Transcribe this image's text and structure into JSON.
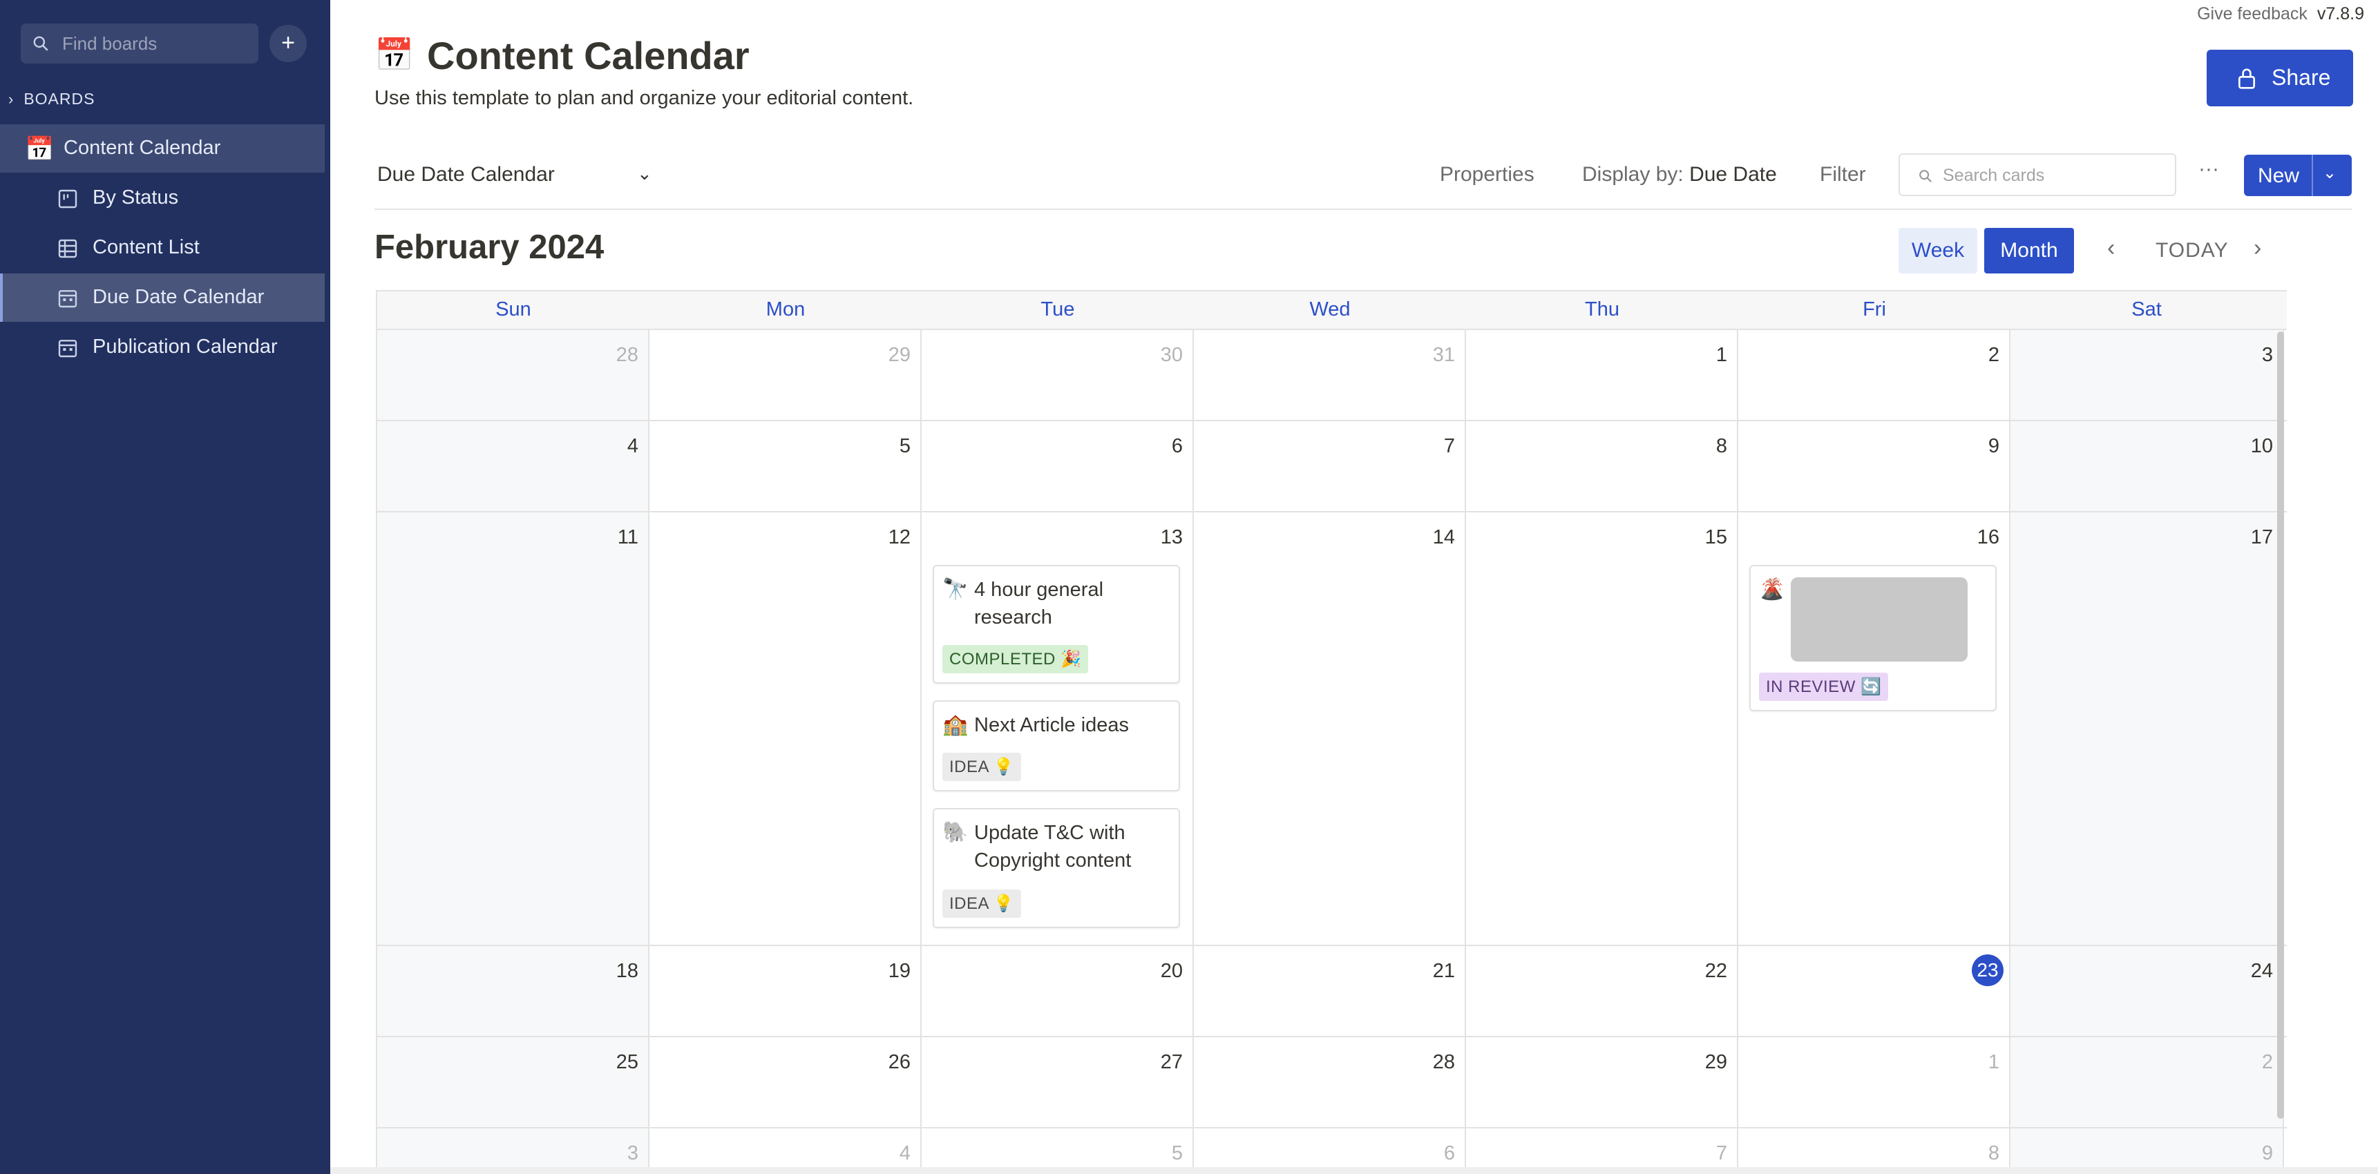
{
  "sidebar": {
    "search_placeholder": "Find boards",
    "add_label": "+",
    "boards_heading": "BOARDS",
    "board": {
      "emoji": "📅",
      "label": "Content Calendar"
    },
    "views": [
      {
        "label": "By Status",
        "icon": "board-icon"
      },
      {
        "label": "Content List",
        "icon": "table-icon"
      },
      {
        "label": "Due Date Calendar",
        "icon": "calendar-icon",
        "current": true
      },
      {
        "label": "Publication Calendar",
        "icon": "calendar-icon"
      }
    ]
  },
  "header": {
    "feedback": "Give feedback",
    "version": "v7.8.9",
    "emoji": "📅",
    "title": "Content Calendar",
    "subtitle": "Use this template to plan and organize your editorial content.",
    "share_label": "Share"
  },
  "toolbar": {
    "view_name": "Due Date Calendar",
    "properties": "Properties",
    "display_by_label": "Display by:",
    "display_by_value": "Due Date",
    "filter": "Filter",
    "search_placeholder": "Search cards",
    "more": "···",
    "new_label": "New"
  },
  "calendar": {
    "month_label": "February 2024",
    "week_label": "Week",
    "month_btn_label": "Month",
    "today_label": "TODAY",
    "weekdays": [
      "Sun",
      "Mon",
      "Tue",
      "Wed",
      "Thu",
      "Fri",
      "Sat"
    ],
    "weeks": [
      [
        "28",
        "29",
        "30",
        "31",
        "1",
        "2",
        "3"
      ],
      [
        "4",
        "5",
        "6",
        "7",
        "8",
        "9",
        "10"
      ],
      [
        "11",
        "12",
        "13",
        "14",
        "15",
        "16",
        "17"
      ],
      [
        "18",
        "19",
        "20",
        "21",
        "22",
        "23",
        "24"
      ],
      [
        "25",
        "26",
        "27",
        "28",
        "29",
        "1",
        "2"
      ],
      [
        "3",
        "4",
        "5",
        "6",
        "7",
        "8",
        "9"
      ]
    ],
    "today": "23"
  },
  "cards": {
    "c1": {
      "emoji": "🔭",
      "title": "4 hour general research",
      "status": "COMPLETED 🎉"
    },
    "c2": {
      "emoji": "🏫",
      "title": "Next Article ideas",
      "status": "IDEA 💡"
    },
    "c3": {
      "emoji": "🐘",
      "title": "Update T&C with Copyright content",
      "status": "IDEA 💡"
    },
    "c4": {
      "emoji": "🌋",
      "title": "",
      "status": "IN REVIEW 🔄"
    }
  },
  "colors": {
    "sidebar": "#22305f",
    "accent": "#2c4fc8"
  }
}
